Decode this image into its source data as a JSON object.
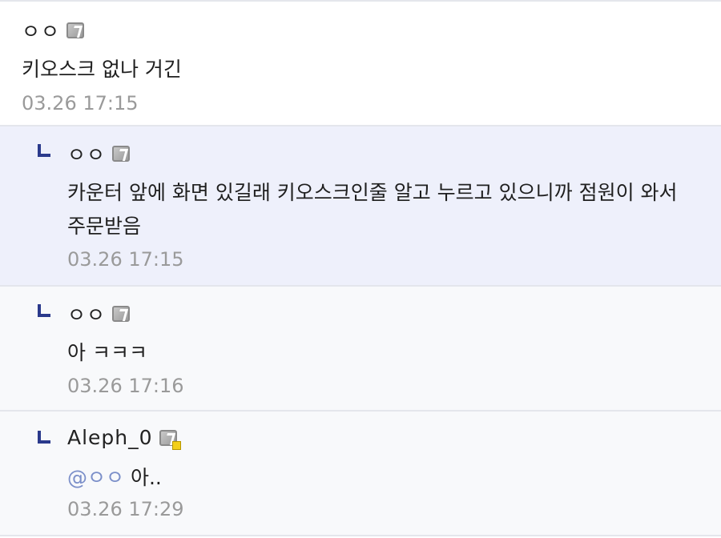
{
  "comments": [
    {
      "nick": "ㅇㅇ",
      "text": "키오스크 없나 거긴",
      "date": "03.26 17:15"
    },
    {
      "nick": "ㅇㅇ",
      "text": "카운터 앞에 화면 있길래 키오스크인줄 알고 누르고 있으니까 점원이 와서 주문받음",
      "date": "03.26 17:15"
    },
    {
      "nick": "ㅇㅇ",
      "text": "아 ㅋㅋㅋ",
      "date": "03.26 17:16"
    },
    {
      "nick": "Aleph_0",
      "mention": "@ㅇㅇ",
      "text": "아..",
      "date": "03.26 17:29"
    }
  ],
  "icons": {
    "reply_marker": "reply-arrow-icon",
    "gonik": "gonik-badge-icon",
    "fixed_gonik": "fixed-nick-badge-icon"
  },
  "colors": {
    "reply_marker": "#2b3a8c",
    "mention": "#7b8fc9",
    "date": "#9a9a9a",
    "highlight_bg": "#eef0fb",
    "reply_bg": "#f8f9fb"
  }
}
